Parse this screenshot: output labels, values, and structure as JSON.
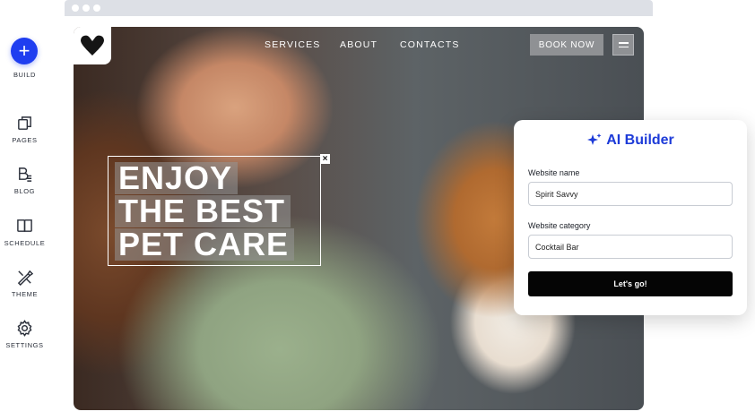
{
  "sidebar": {
    "build_label": "BUILD",
    "items": [
      {
        "label": "PAGES",
        "icon": "pages-icon"
      },
      {
        "label": "BLOG",
        "icon": "blog-icon"
      },
      {
        "label": "SCHEDULE",
        "icon": "schedule-icon"
      },
      {
        "label": "THEME",
        "icon": "theme-icon"
      },
      {
        "label": "SETTINGS",
        "icon": "settings-icon"
      }
    ]
  },
  "site": {
    "nav": [
      "SERVICES",
      "ABOUT",
      "CONTACTS"
    ],
    "book_label": "BOOK NOW",
    "headline": [
      "ENJOY",
      "THE BEST",
      "PET CARE"
    ],
    "close_label": "×"
  },
  "ai_builder": {
    "title": "AI Builder",
    "name_label": "Website name",
    "name_value": "Spirit Savvy",
    "category_label": "Website category",
    "category_value": "Cocktail Bar",
    "submit_label": "Let's go!"
  },
  "colors": {
    "accent": "#1f3ef0",
    "title_blue": "#1d3bd8",
    "button_black": "#050505"
  }
}
